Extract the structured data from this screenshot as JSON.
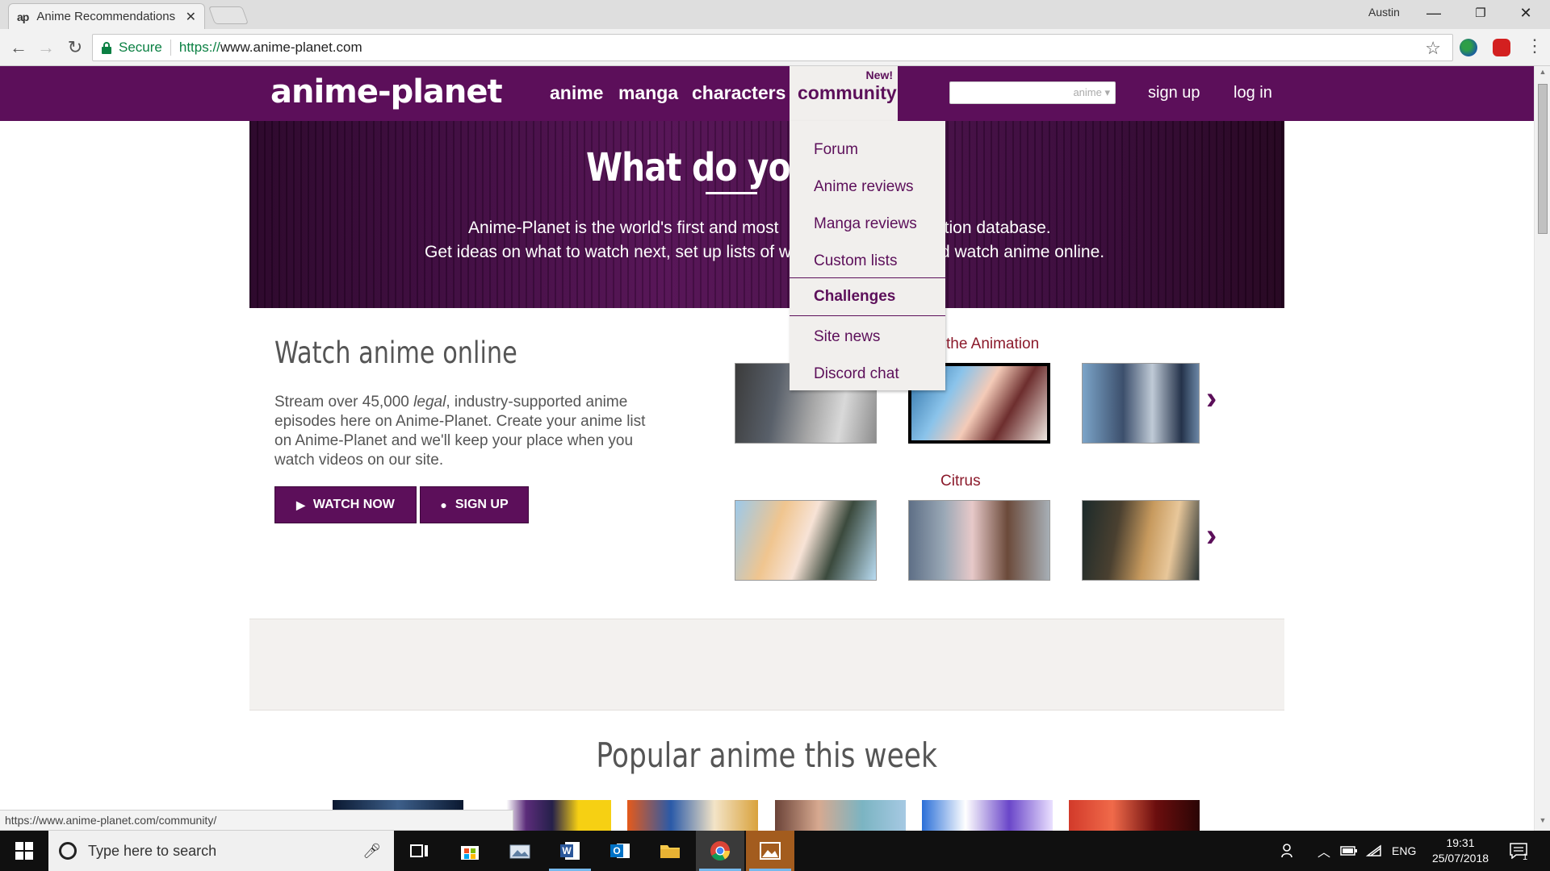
{
  "browser": {
    "tab_title": "Anime Recommendations",
    "tab_favicon": "ap",
    "profile": "Austin",
    "secure_label": "Secure",
    "url_scheme": "https://",
    "url_host": "www.anime-planet.com",
    "status_url": "https://www.anime-planet.com/community/"
  },
  "site": {
    "logo": "anime-planet",
    "nav": [
      "anime",
      "manga",
      "characters"
    ],
    "community_label": "community",
    "new_badge": "New!",
    "search_scope": "anime",
    "signup": "sign up",
    "login": "log in"
  },
  "hero": {
    "headline": "What do you re",
    "line1_left": "Anime-Planet is the world's first and most",
    "line1_right": "ation database.",
    "line2_left": "Get ideas on what to watch next, set up lists of w",
    "line2_right": "d watch anime online."
  },
  "watch": {
    "title": "Watch anime online",
    "desc_pre": "Stream over 45,000 ",
    "desc_em": "legal",
    "desc_post": ", industry-supported anime episodes here on Anime-Planet. Create your anime list on Anime-Planet and we'll keep your place when you watch videos on our site.",
    "watch_now": "WATCH NOW",
    "sign_up": "SIGN UP"
  },
  "carousels": [
    {
      "title": "the Animation"
    },
    {
      "title": "Citrus"
    }
  ],
  "dropdown": {
    "items": [
      "Forum",
      "Anime reviews",
      "Manga reviews",
      "Custom lists",
      "Challenges",
      "Site news",
      "Discord chat"
    ],
    "active": "Challenges"
  },
  "popular_title": "Popular anime this week",
  "taskbar": {
    "search_placeholder": "Type here to search",
    "lang": "ENG",
    "time": "19:31",
    "date": "25/07/2018",
    "notification_count": "1"
  },
  "colors": {
    "brand": "#5c0f5a",
    "link_red": "#8b1a2b",
    "secure_green": "#0b8043"
  }
}
